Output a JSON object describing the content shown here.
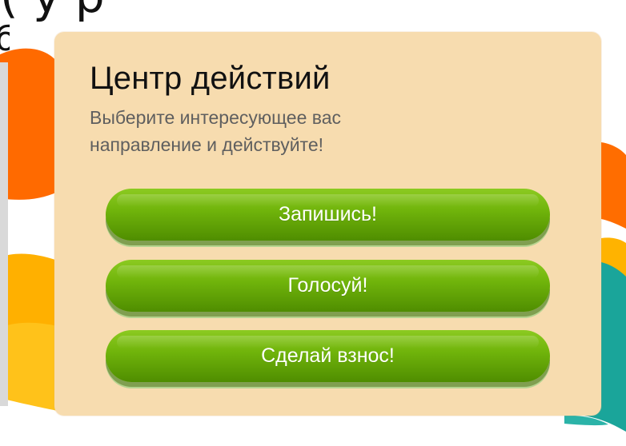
{
  "top_fragment": {
    "text": "(                     у             р"
  },
  "left_fragment": {
    "text": "б"
  },
  "action_center": {
    "title": "Центр действий",
    "subtitle": "Выберите интересующее вас направление и действуйте!",
    "buttons": [
      {
        "label": "Запишись!"
      },
      {
        "label": "Голосуй!"
      },
      {
        "label": "Сделай взнос!"
      }
    ]
  },
  "colors": {
    "panel": "#f7dcaf",
    "button_green": "#70b40b",
    "title_text": "#111111",
    "subtitle_text": "#5f5f5f",
    "orange_art": "#ff6d00",
    "yellow_art": "#ffb300",
    "teal_art": "#1aa59a"
  }
}
